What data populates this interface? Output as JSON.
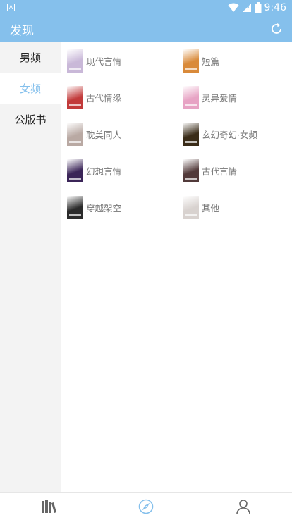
{
  "status_bar": {
    "time": "9:46",
    "battery_level": "8",
    "app_badge": "A"
  },
  "header": {
    "title": "发现"
  },
  "sidebar": {
    "items": [
      {
        "label": "男频",
        "active": false
      },
      {
        "label": "女频",
        "active": true
      },
      {
        "label": "公版书",
        "active": false
      }
    ]
  },
  "categories": [
    {
      "label": "现代言情",
      "cover": "#c9b8d8"
    },
    {
      "label": "短篇",
      "cover": "#d98a3a"
    },
    {
      "label": "古代情缘",
      "cover": "#c23a3a"
    },
    {
      "label": "灵异爱情",
      "cover": "#e7a3c4"
    },
    {
      "label": "耽美同人",
      "cover": "#b9a9a3"
    },
    {
      "label": "玄幻奇幻·女频",
      "cover": "#3a2c18"
    },
    {
      "label": "幻想言情",
      "cover": "#3b2558"
    },
    {
      "label": "古代言情",
      "cover": "#523a3a"
    },
    {
      "label": "穿越架空",
      "cover": "#2a2a2a"
    },
    {
      "label": "其他",
      "cover": "#d8d2cf"
    }
  ],
  "colors": {
    "accent": "#85c0ec",
    "sidebar_bg": "#f3f3f3"
  },
  "bottom_nav": [
    {
      "icon": "bookshelf-icon",
      "active": false
    },
    {
      "icon": "compass-icon",
      "active": true
    },
    {
      "icon": "user-icon",
      "active": false
    }
  ]
}
